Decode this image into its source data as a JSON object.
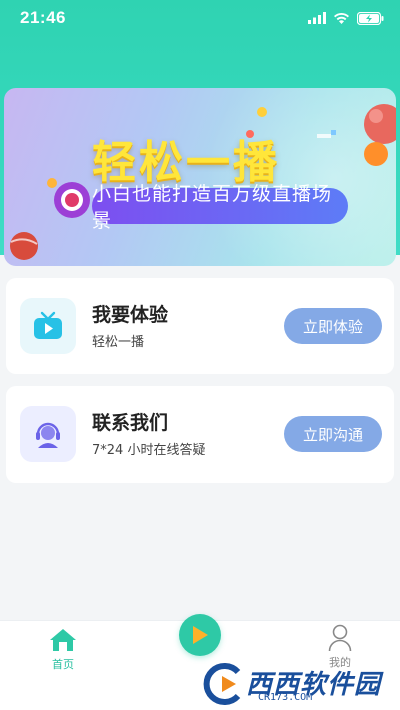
{
  "status_bar": {
    "time": "21:46"
  },
  "banner": {
    "title": "轻松一播",
    "subtitle": "小白也能打造百万级直播场景"
  },
  "cards": [
    {
      "title": "我要体验",
      "subtitle": "轻松一播",
      "button": "立即体验",
      "icon": "tv-play-icon"
    },
    {
      "title": "联系我们",
      "subtitle": "7*24 小时在线答疑",
      "button": "立即沟通",
      "icon": "customer-service-icon"
    }
  ],
  "tabbar": {
    "home_label": "首页",
    "mine_label": "我的"
  },
  "watermark": {
    "brand": "西西软件园",
    "url": "CR173.COM"
  },
  "colors": {
    "accent": "#2ec9a6",
    "button": "#84a9e6",
    "banner_title": "#ffe63a"
  }
}
